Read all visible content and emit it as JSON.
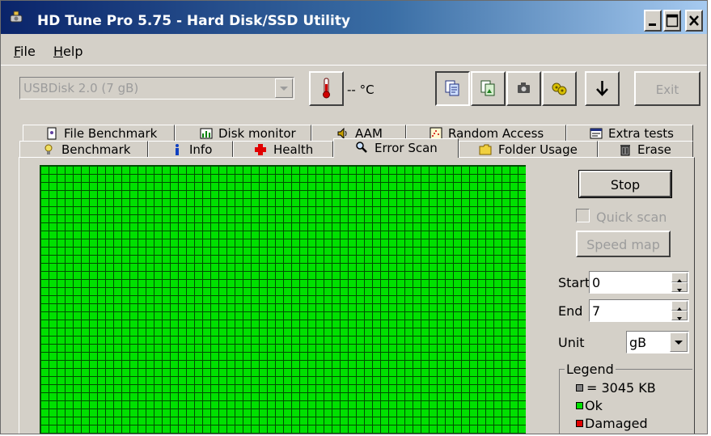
{
  "window": {
    "title": "HD Tune Pro 5.75 - Hard Disk/SSD Utility"
  },
  "menu": {
    "file": "File",
    "file_key": "F",
    "file_rest": "ile",
    "help": "Help",
    "help_key": "H",
    "help_rest": "elp"
  },
  "toolbar": {
    "drive": "USBDisk 2.0 (7 gB)",
    "temperature": "-- °C",
    "exit_label": "Exit",
    "icons": [
      "copy-text-icon",
      "copy-image-icon",
      "screenshot-camera-icon",
      "options-icon",
      "save-download-icon"
    ]
  },
  "tabs": {
    "row_top": [
      {
        "label": "File Benchmark",
        "icon": "file-benchmark-icon"
      },
      {
        "label": "Disk monitor",
        "icon": "disk-monitor-icon"
      },
      {
        "label": "AAM",
        "icon": "speaker-icon"
      },
      {
        "label": "Random Access",
        "icon": "random-access-icon"
      },
      {
        "label": "Extra tests",
        "icon": "extra-tests-icon"
      }
    ],
    "row_bottom": [
      {
        "label": "Benchmark",
        "icon": "benchmark-icon"
      },
      {
        "label": "Info",
        "icon": "info-icon"
      },
      {
        "label": "Health",
        "icon": "health-cross-icon"
      },
      {
        "label": "Error Scan",
        "icon": "magnifier-icon"
      },
      {
        "label": "Folder Usage",
        "icon": "folder-icon"
      },
      {
        "label": "Erase",
        "icon": "trash-icon"
      }
    ],
    "active": "Error Scan"
  },
  "scan": {
    "stop_label": "Stop",
    "quick_scan_label": "Quick scan",
    "quick_scan_checked": false,
    "speed_map_label": "Speed map",
    "start_label": "Start",
    "start_value": "0",
    "end_label": "End",
    "end_value": "7",
    "unit_label": "Unit",
    "unit_value": "gB"
  },
  "legend": {
    "title": "Legend",
    "items": [
      {
        "label": "= 3045 KB",
        "color": "#808080"
      },
      {
        "label": "Ok",
        "color": "#00e000"
      },
      {
        "label": "Damaged",
        "color": "#e00000"
      }
    ]
  },
  "colors": {
    "ok_block": "#00e000",
    "grid_line": "#004d00",
    "title_bar_start": "#0a246a"
  }
}
